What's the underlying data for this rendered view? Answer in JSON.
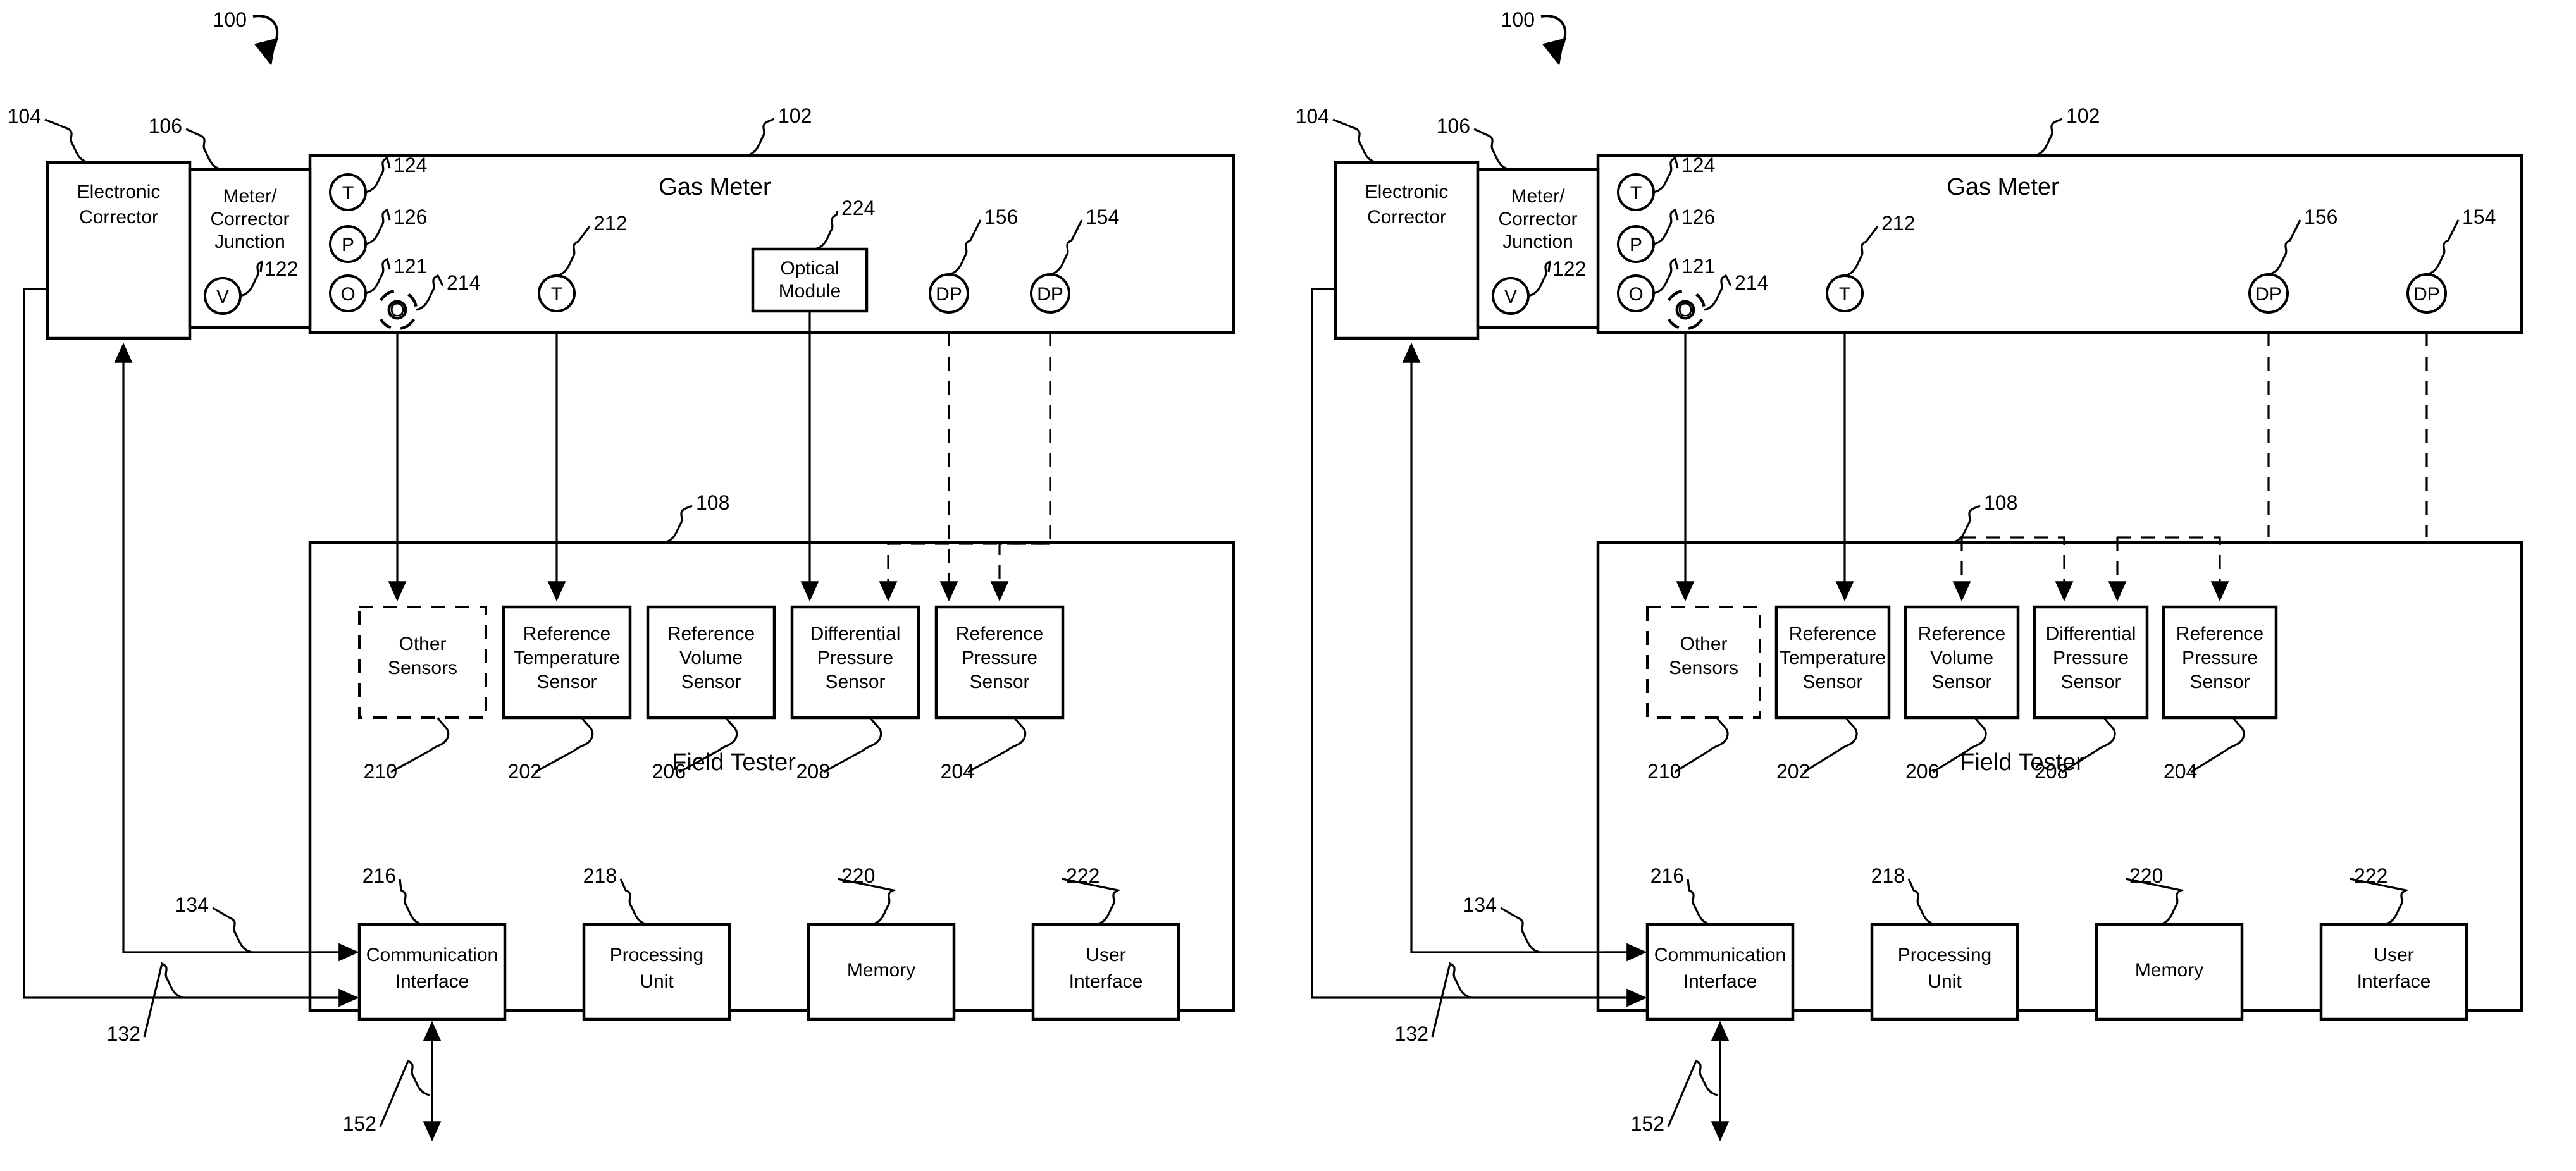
{
  "figure": {
    "system_ref": "100",
    "panels": [
      {
        "id": "left",
        "has_optical_module": true
      },
      {
        "id": "right",
        "has_optical_module": false
      }
    ]
  },
  "blocks": {
    "electronic_corrector": {
      "label_line1": "Electronic",
      "label_line2": "Corrector",
      "ref": "104"
    },
    "meter_corrector_junction": {
      "label_line1": "Meter/",
      "label_line2": "Corrector",
      "label_line3": "Junction",
      "ref": "106"
    },
    "gas_meter": {
      "label": "Gas Meter",
      "ref": "102"
    },
    "field_tester": {
      "label": "Field Tester",
      "ref": "108"
    },
    "optical_module": {
      "label_line1": "Optical",
      "label_line2": "Module",
      "ref": "224"
    }
  },
  "meter_symbols": [
    {
      "glyph": "T",
      "ref": "124",
      "name": "meter-temperature-symbol"
    },
    {
      "glyph": "P",
      "ref": "126",
      "name": "meter-pressure-symbol"
    },
    {
      "glyph": "O",
      "ref": "121",
      "name": "meter-output-symbol"
    },
    {
      "glyph": "O",
      "ref": "214",
      "name": "meter-optical-output-symbol"
    },
    {
      "glyph": "T",
      "ref": "212",
      "name": "meter-reference-temperature-tap"
    },
    {
      "glyph": "DP",
      "ref": "156",
      "name": "meter-differential-pressure-tap-156"
    },
    {
      "glyph": "DP",
      "ref": "154",
      "name": "meter-differential-pressure-tap-154"
    }
  ],
  "junction_symbols": [
    {
      "glyph": "V",
      "ref": "122",
      "name": "junction-volume-symbol"
    }
  ],
  "sensors": [
    {
      "label_line1": "Other",
      "label_line2": "Sensors",
      "label_line3": "",
      "ref": "210",
      "dashed": true,
      "name": "other-sensors-block"
    },
    {
      "label_line1": "Reference",
      "label_line2": "Temperature",
      "label_line3": "Sensor",
      "ref": "202",
      "dashed": false,
      "name": "reference-temperature-sensor-block"
    },
    {
      "label_line1": "Reference",
      "label_line2": "Volume",
      "label_line3": "Sensor",
      "ref": "206",
      "dashed": false,
      "name": "reference-volume-sensor-block"
    },
    {
      "label_line1": "Differential",
      "label_line2": "Pressure",
      "label_line3": "Sensor",
      "ref": "208",
      "dashed": false,
      "name": "differential-pressure-sensor-block"
    },
    {
      "label_line1": "Reference",
      "label_line2": "Pressure",
      "label_line3": "Sensor",
      "ref": "204",
      "dashed": false,
      "name": "reference-pressure-sensor-block"
    }
  ],
  "modules": [
    {
      "label_line1": "Communication",
      "label_line2": "Interface",
      "ref": "216",
      "name": "communication-interface-block"
    },
    {
      "label_line1": "Processing",
      "label_line2": "Unit",
      "ref": "218",
      "name": "processing-unit-block"
    },
    {
      "label_line1": "Memory",
      "label_line2": "",
      "ref": "220",
      "name": "memory-block"
    },
    {
      "label_line1": "User",
      "label_line2": "Interface",
      "ref": "222",
      "name": "user-interface-block"
    }
  ],
  "links": [
    {
      "ref": "132",
      "name": "link-132-corrector-to-comm"
    },
    {
      "ref": "134",
      "name": "link-134-comm-to-corrector"
    },
    {
      "ref": "152",
      "name": "link-152-external-comm"
    }
  ],
  "colors": {
    "ink": "#000000",
    "paper": "#ffffff"
  }
}
